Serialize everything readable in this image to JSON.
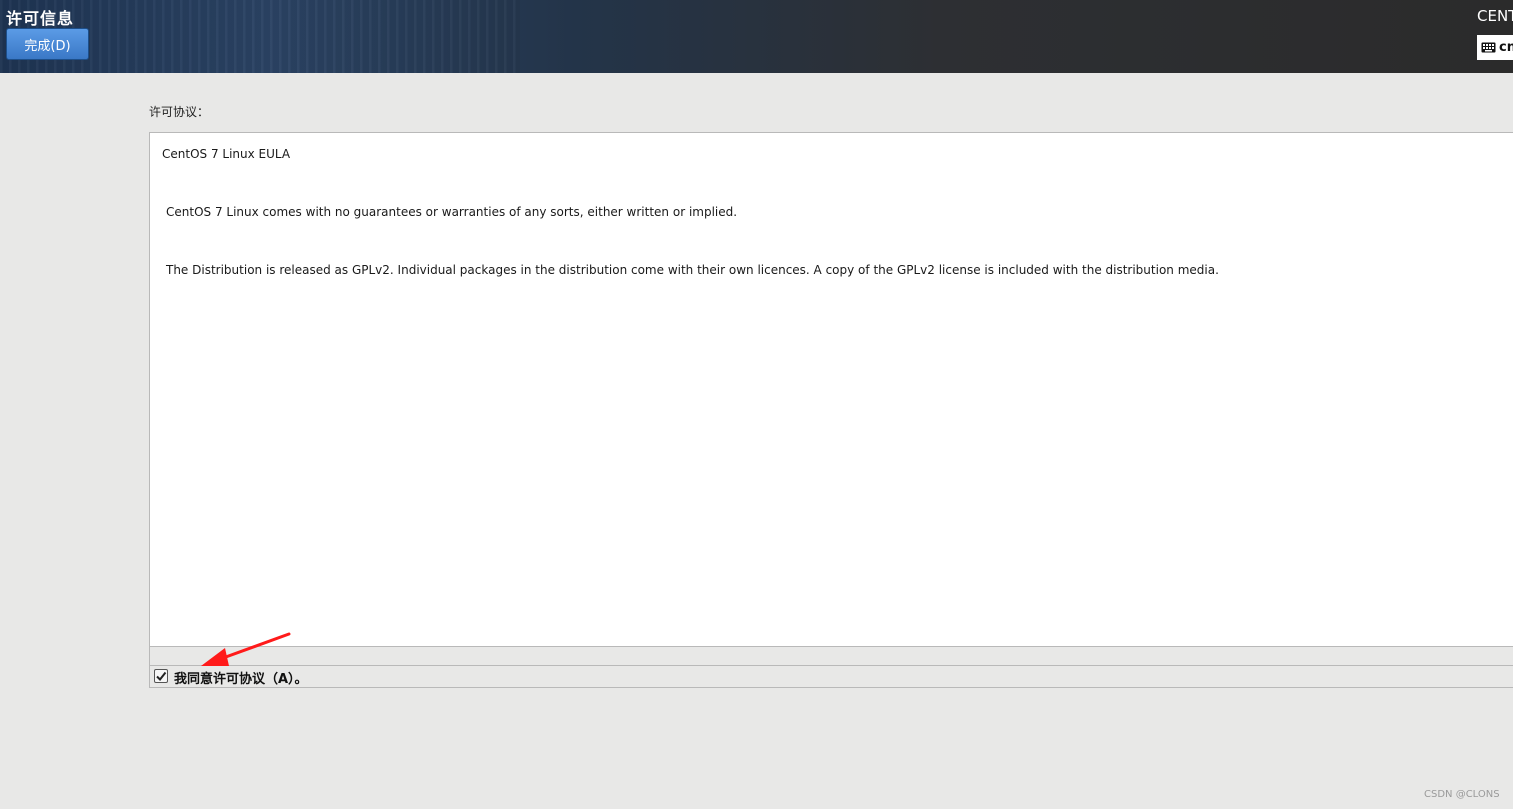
{
  "header": {
    "title": "许可信息",
    "done_button": "完成(D)",
    "product_name": "CENTOS",
    "keyboard_layout": "cn",
    "keyboard_icon": "keyboard-icon"
  },
  "license": {
    "section_label": "许可协议：",
    "heading": "CentOS 7 Linux EULA",
    "paragraphs": [
      "CentOS 7 Linux comes with no guarantees or warranties of any sorts, either written or implied.",
      "The Distribution is released as GPLv2. Individual packages in the distribution come with their own licences. A copy of the GPLv2 license is included with the distribution media."
    ]
  },
  "agreement": {
    "label": "我同意许可协议（A）。",
    "checked": true,
    "check_icon": "checkmark-icon"
  },
  "annotation": {
    "arrow_icon": "red-arrow-icon",
    "arrow_color": "#ff1a1a"
  },
  "watermark": "CSDN @CLONS",
  "colors": {
    "accent_button": "#3a78c6",
    "header_dark": "#2b2b2b",
    "background": "#e8e8e7"
  }
}
